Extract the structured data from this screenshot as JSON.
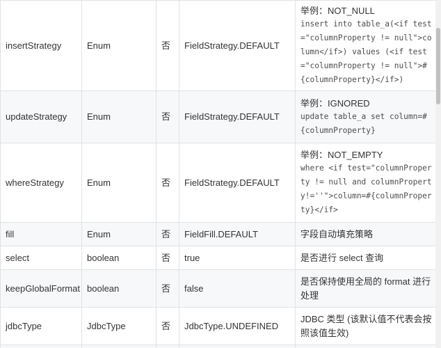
{
  "rows": [
    {
      "name": "insertStrategy",
      "type": "Enum",
      "required": "否",
      "default": "FieldStrategy.DEFAULT",
      "example_title": "举例：NOT_NULL",
      "example_code": "insert into table_a(<if test=\"columnProperty != null\">column</if>) values (<if test=\"columnProperty != null\">#{columnProperty}</if>)"
    },
    {
      "name": "updateStrategy",
      "type": "Enum",
      "required": "否",
      "default": "FieldStrategy.DEFAULT",
      "example_title": "举例：IGNORED",
      "example_code": "update table_a set column=#{columnProperty}"
    },
    {
      "name": "whereStrategy",
      "type": "Enum",
      "required": "否",
      "default": "FieldStrategy.DEFAULT",
      "example_title": "举例：NOT_EMPTY",
      "example_code": "where <if test=\"columnProperty != null and columnProperty!=''\">column=#{columnProperty}</if>"
    },
    {
      "name": "fill",
      "type": "Enum",
      "required": "否",
      "default": "FieldFill.DEFAULT",
      "description": "字段自动填充策略"
    },
    {
      "name": "select",
      "type": "boolean",
      "required": "否",
      "default": "true",
      "description": "是否进行 select 查询"
    },
    {
      "name": "keepGlobalFormat",
      "type": "boolean",
      "required": "否",
      "default": "false",
      "description": "是否保持使用全局的 format 进行处理"
    },
    {
      "name": "jdbcType",
      "type": "JdbcType",
      "required": "否",
      "default": "JdbcType.UNDEFINED",
      "description": "JDBC 类型 (该默认值不代表会按照该值生效)"
    }
  ]
}
